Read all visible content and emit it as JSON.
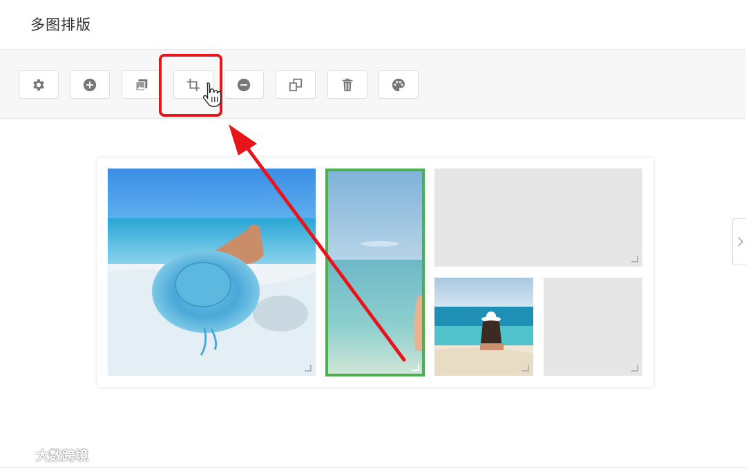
{
  "header": {
    "title": "多图排版"
  },
  "toolbar": {
    "tools": [
      {
        "icon": "gear-icon"
      },
      {
        "icon": "plus-circle-icon"
      },
      {
        "icon": "image-stack-icon"
      },
      {
        "icon": "crop-icon",
        "highlighted": true
      },
      {
        "icon": "minus-circle-icon"
      },
      {
        "icon": "copy-icon"
      },
      {
        "icon": "trash-icon"
      },
      {
        "icon": "palette-icon"
      }
    ]
  },
  "layout": {
    "cells": [
      {
        "content": "photo-woman-hat-beach",
        "selected": false
      },
      {
        "content": "photo-sea-horizon",
        "selected": true
      },
      {
        "content": "empty",
        "selected": false
      },
      {
        "content": "photo-woman-beach-sitting",
        "selected": false
      },
      {
        "content": "empty",
        "selected": false
      }
    ]
  },
  "watermark": {
    "text": "大数跨境"
  },
  "colors": {
    "highlight": "#e8141b",
    "selected_border": "#4caf50",
    "empty_cell": "#e6e6e6",
    "toolbar_bg": "#f7f7f7"
  }
}
